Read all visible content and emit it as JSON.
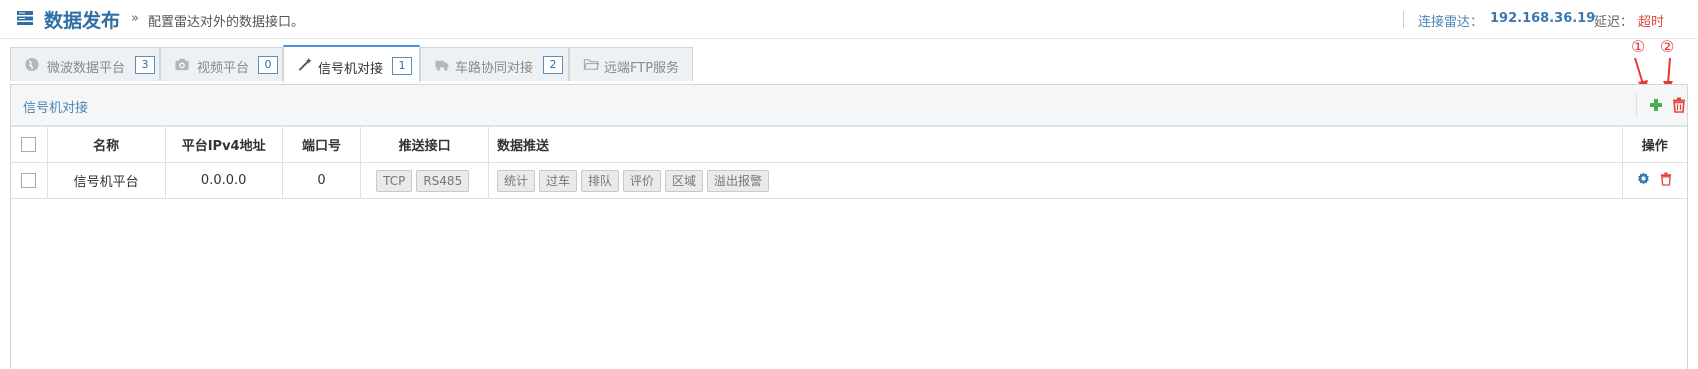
{
  "header": {
    "title": "数据发布",
    "separator": "»",
    "description": "配置雷达对外的数据接口。",
    "connection_label": "连接雷达：",
    "connection_ip": "192.168.36.19",
    "delay_label": "延迟：",
    "delay_value": "超时"
  },
  "annotations": [
    "①",
    "②"
  ],
  "tabs": [
    {
      "label": "微波数据平台",
      "count": "3",
      "icon": "globe-icon",
      "active": false
    },
    {
      "label": "视频平台",
      "count": "0",
      "icon": "camera-icon",
      "active": false
    },
    {
      "label": "信号机对接",
      "count": "1",
      "icon": "magic-wand-icon",
      "active": true
    },
    {
      "label": "车路协同对接",
      "count": "2",
      "icon": "truck-icon",
      "active": false
    },
    {
      "label": "远端FTP服务",
      "count": "",
      "icon": "folder-icon",
      "active": false
    }
  ],
  "panel": {
    "title": "信号机对接",
    "columns": [
      "名称",
      "平台IPv4地址",
      "端口号",
      "推送接口",
      "数据推送",
      "操作"
    ],
    "rows": [
      {
        "name": "信号机平台",
        "ip": "0.0.0.0",
        "port": "0",
        "interfaces": [
          "TCP",
          "RS485"
        ],
        "push": [
          "统计",
          "过车",
          "排队",
          "评价",
          "区域",
          "溢出报警"
        ]
      }
    ]
  },
  "colors": {
    "accent": "#2f6fa6",
    "add": "#4caf50",
    "delete": "#e0483b",
    "annotation": "#e53935"
  }
}
